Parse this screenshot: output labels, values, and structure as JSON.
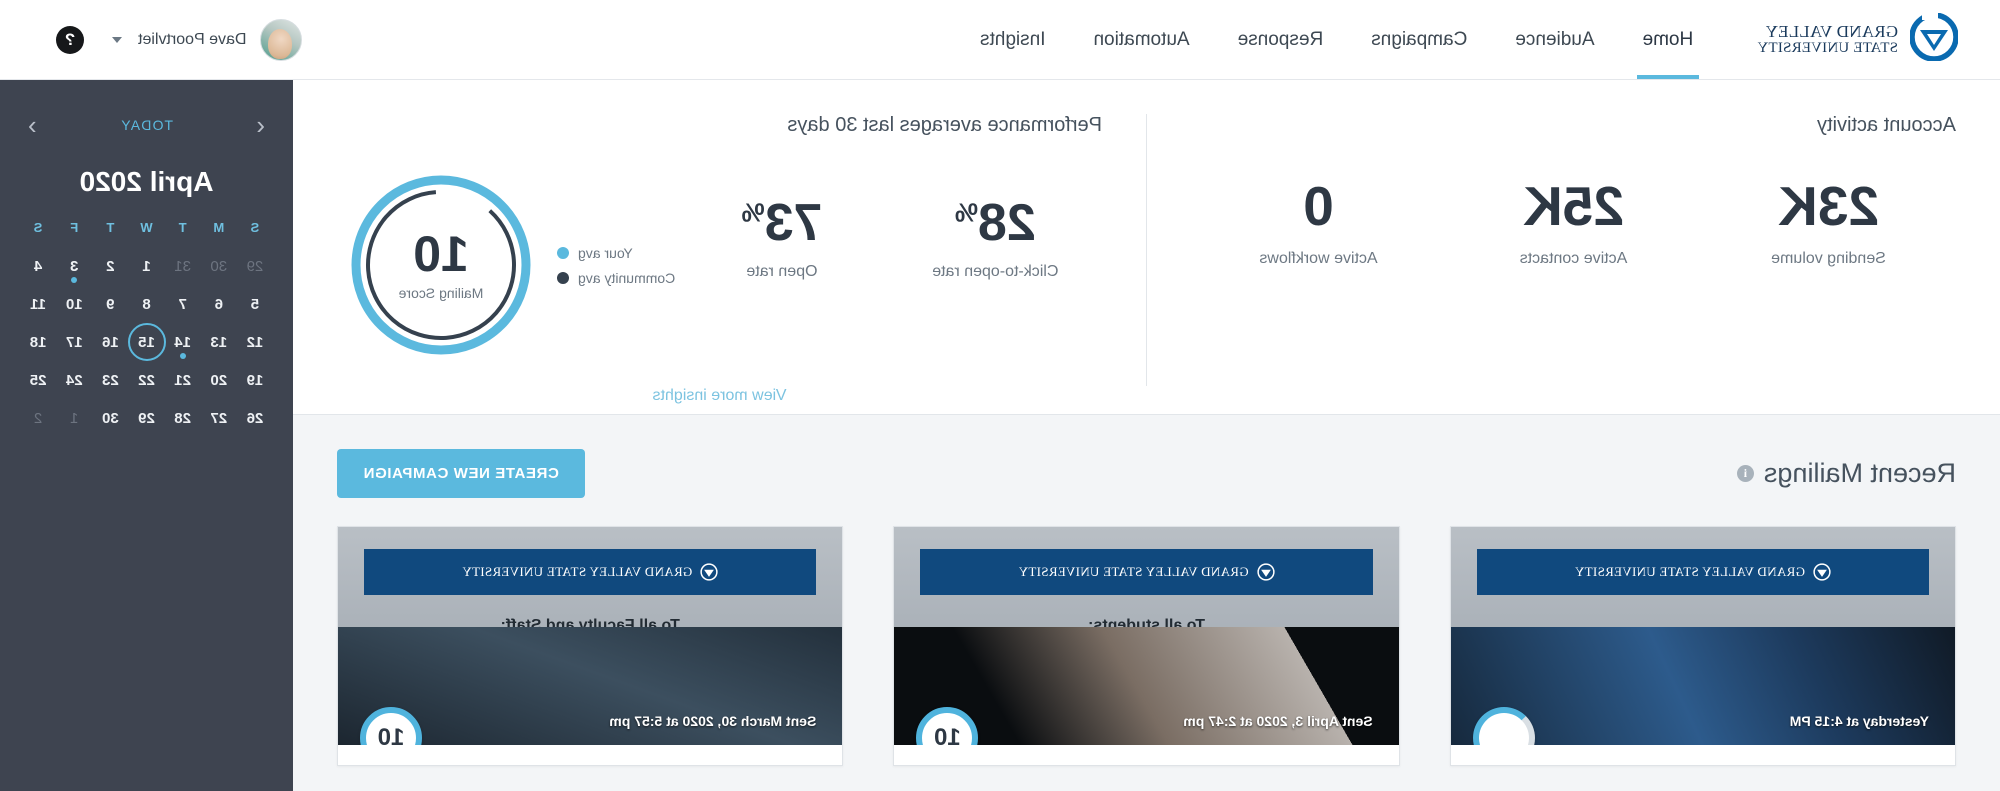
{
  "brand": {
    "name_line1": "GRAND VALLEY",
    "name_line2": "STATE UNIVERSITY",
    "logo_icon": "gvsu-logo-icon",
    "logo_color": "#0a6ab0"
  },
  "nav": {
    "items": [
      {
        "label": "Home",
        "active": true
      },
      {
        "label": "Audience",
        "active": false
      },
      {
        "label": "Campaigns",
        "active": false
      },
      {
        "label": "Response",
        "active": false
      },
      {
        "label": "Automation",
        "active": false
      },
      {
        "label": "Insights",
        "active": false
      }
    ],
    "active_underline_color": "#5bb9de"
  },
  "account_menu": {
    "user_name": "Dave Poortvliet",
    "caret_icon": "chevron-down-icon",
    "avatar_icon": "user-avatar",
    "help_icon": "question-mark-icon",
    "help_label": "?"
  },
  "account_activity": {
    "title": "Account activity",
    "stats": [
      {
        "value": "23K",
        "label": "Sending volume"
      },
      {
        "value": "25K",
        "label": "Active contacts"
      },
      {
        "value": "0",
        "label": "Active workflows"
      }
    ]
  },
  "performance": {
    "title": "Performance averages last 30 days",
    "gauge": {
      "value": "10",
      "caption": "Mailing Score",
      "your_avg_color": "#5bb9de",
      "community_avg_color": "#35414e"
    },
    "legend": [
      {
        "label": "Your avg",
        "color": "#5bb9de"
      },
      {
        "label": "Community avg",
        "color": "#35414e"
      }
    ],
    "stats": [
      {
        "value": "73",
        "unit": "%",
        "label": "Open rate"
      },
      {
        "value": "28",
        "unit": "%",
        "label": "Click-to-open rate"
      }
    ],
    "view_more_label": "View more insights",
    "view_more_color": "#7cc3e0"
  },
  "recent_mailings": {
    "title": "Recent Mailings",
    "info_icon": "info-icon",
    "info_label": "i",
    "create_button_label": "CREATE NEW CAMPAIGN",
    "create_button_color": "#5bb9de",
    "cards": [
      {
        "banner_text": "GRAND VALLEY STATE UNIVERSITY",
        "heading": "To all Faculty and Staff:",
        "caption": "Sent March 30, 2020 at 5:57 pm",
        "score": "10",
        "score_state": "full"
      },
      {
        "banner_text": "GRAND VALLEY STATE UNIVERSITY",
        "heading": "To all students:",
        "caption": "Sent April 3, 2020 at 2:47 pm",
        "score": "10",
        "score_state": "full"
      },
      {
        "banner_text": "GRAND VALLEY STATE UNIVERSITY",
        "heading": "",
        "caption": "Yesterday at 4:15 PM",
        "score": "",
        "score_state": "partial"
      }
    ]
  },
  "calendar": {
    "prev_icon": "chevron-left-icon",
    "next_icon": "chevron-right-icon",
    "today_label": "TODAY",
    "month_label": "April 2020",
    "day_headers": [
      "S",
      "M",
      "T",
      "W",
      "T",
      "F",
      "S"
    ],
    "selected_day": 15,
    "accent_color": "#5bb9de",
    "panel_color": "#3e4450",
    "weeks": [
      [
        {
          "d": "29",
          "muted": true
        },
        {
          "d": "30",
          "muted": true
        },
        {
          "d": "31",
          "muted": true
        },
        {
          "d": "1",
          "muted": false
        },
        {
          "d": "2",
          "muted": false
        },
        {
          "d": "3",
          "muted": false,
          "event": true
        },
        {
          "d": "4",
          "muted": false
        }
      ],
      [
        {
          "d": "5",
          "muted": false
        },
        {
          "d": "6",
          "muted": false
        },
        {
          "d": "7",
          "muted": false
        },
        {
          "d": "8",
          "muted": false
        },
        {
          "d": "9",
          "muted": false
        },
        {
          "d": "10",
          "muted": false
        },
        {
          "d": "11",
          "muted": false
        }
      ],
      [
        {
          "d": "12",
          "muted": false
        },
        {
          "d": "13",
          "muted": false
        },
        {
          "d": "14",
          "muted": false,
          "event": true
        },
        {
          "d": "15",
          "muted": false,
          "selected": true
        },
        {
          "d": "16",
          "muted": false
        },
        {
          "d": "17",
          "muted": false
        },
        {
          "d": "18",
          "muted": false
        }
      ],
      [
        {
          "d": "19",
          "muted": false
        },
        {
          "d": "20",
          "muted": false
        },
        {
          "d": "21",
          "muted": false
        },
        {
          "d": "22",
          "muted": false
        },
        {
          "d": "23",
          "muted": false
        },
        {
          "d": "24",
          "muted": false
        },
        {
          "d": "25",
          "muted": false
        }
      ],
      [
        {
          "d": "26",
          "muted": false
        },
        {
          "d": "27",
          "muted": false
        },
        {
          "d": "28",
          "muted": false
        },
        {
          "d": "29",
          "muted": false
        },
        {
          "d": "30",
          "muted": false
        },
        {
          "d": "1",
          "muted": true
        },
        {
          "d": "2",
          "muted": true
        }
      ]
    ]
  }
}
